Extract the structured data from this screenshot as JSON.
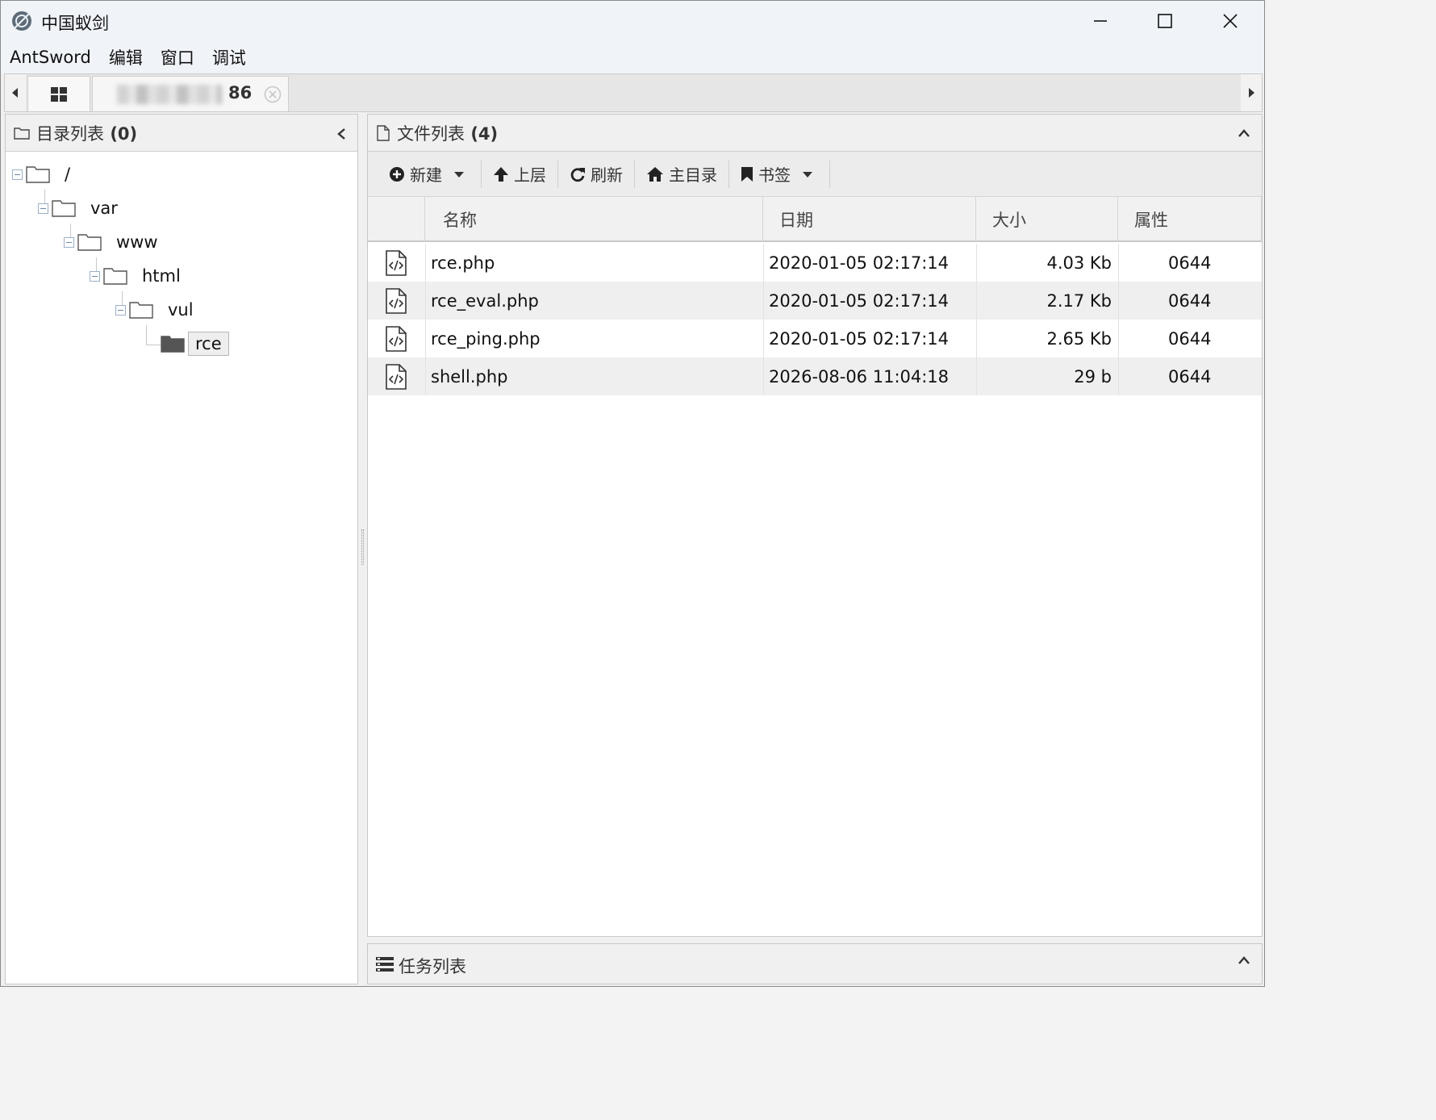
{
  "window": {
    "title": "中国蚁剑",
    "controls": [
      "minimize",
      "maximize",
      "close"
    ]
  },
  "menu": {
    "items": [
      "AntSword",
      "编辑",
      "窗口",
      "调试"
    ]
  },
  "tabs": {
    "session_suffix": "86"
  },
  "directory_panel": {
    "title": "目录列表",
    "count": "(0)",
    "tree": [
      {
        "label": "/",
        "depth": 0,
        "expanded": true
      },
      {
        "label": "var",
        "depth": 1,
        "expanded": true
      },
      {
        "label": "www",
        "depth": 2,
        "expanded": true
      },
      {
        "label": "html",
        "depth": 3,
        "expanded": true
      },
      {
        "label": "vul",
        "depth": 4,
        "expanded": true
      },
      {
        "label": "rce",
        "depth": 5,
        "selected": true
      }
    ]
  },
  "file_panel": {
    "title": "文件列表",
    "count": "(4)",
    "toolbar": {
      "new": "新建",
      "up": "上层",
      "refresh": "刷新",
      "home": "主目录",
      "bookmark": "书签"
    },
    "columns": [
      "名称",
      "日期",
      "大小",
      "属性"
    ],
    "rows": [
      {
        "name": "rce.php",
        "date": "2020-01-05 02:17:14",
        "size": "4.03 Kb",
        "attr": "0644"
      },
      {
        "name": "rce_eval.php",
        "date": "2020-01-05 02:17:14",
        "size": "2.17 Kb",
        "attr": "0644"
      },
      {
        "name": "rce_ping.php",
        "date": "2020-01-05 02:17:14",
        "size": "2.65 Kb",
        "attr": "0644"
      },
      {
        "name": "shell.php",
        "date": "2026-08-06 11:04:18",
        "size": "29 b",
        "attr": "0644"
      }
    ]
  },
  "task_panel": {
    "title": "任务列表"
  }
}
